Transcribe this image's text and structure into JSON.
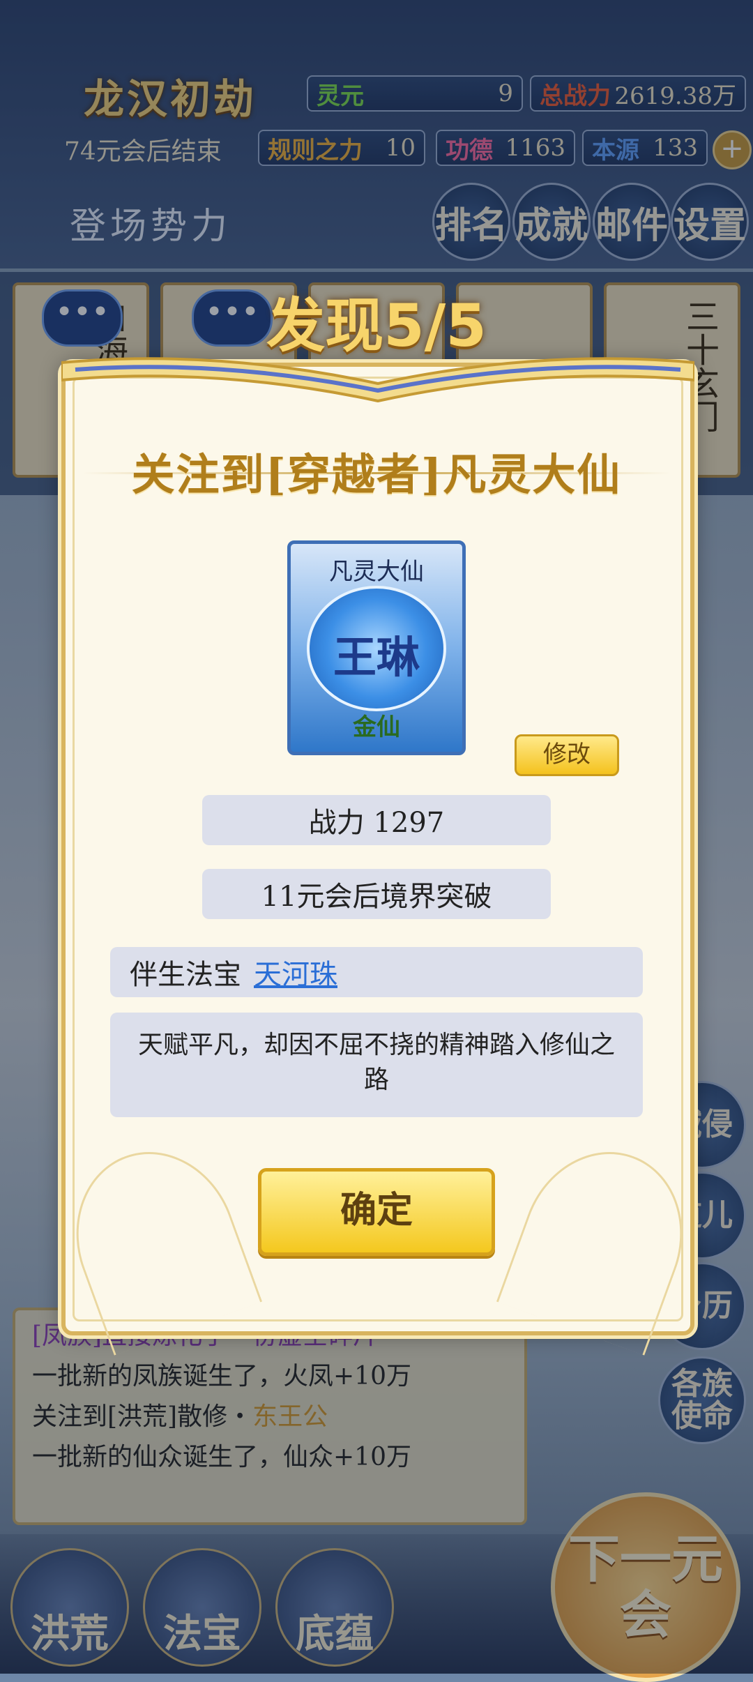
{
  "header": {
    "title": "龙汉初劫",
    "countdown": "74元会后结束",
    "stats": [
      {
        "label": "灵元",
        "value": "9",
        "color": "green"
      },
      {
        "label": "总战力",
        "value": "2619.38万",
        "color": "red"
      },
      {
        "label": "规则之力",
        "value": "10",
        "color": "gold"
      },
      {
        "label": "功德",
        "value": "1163",
        "color": "pink"
      },
      {
        "label": "本源",
        "value": "133",
        "color": "blue"
      }
    ],
    "plus_icon": "plus-icon",
    "faction_label": "登场势力",
    "nav": [
      "排名",
      "成就",
      "邮件",
      "设置"
    ]
  },
  "background_cards": [
    {
      "text": "白海注洋",
      "has_bubble": true
    },
    {
      "text": "",
      "has_bubble": true
    },
    {
      "text": "",
      "has_bubble": false
    },
    {
      "text": "",
      "has_bubble": false
    },
    {
      "text": "三十玄门",
      "has_bubble": false
    }
  ],
  "bubble_glyph": "•••",
  "log": {
    "lines": [
      {
        "text": "[凤族]直接炼化了一份虚空碎片",
        "style": "purple"
      },
      {
        "text": "一批新的凤族诞生了，火凤+10万",
        "style": "normal"
      },
      {
        "prefix": "关注到[洪荒]散修・",
        "highlight": "东王公",
        "style": "mixed"
      },
      {
        "text": "一批新的仙众诞生了，仙众+10万",
        "style": "normal"
      }
    ]
  },
  "side_buttons": [
    "域侵",
    "道儿",
    "身历",
    "各族使命"
  ],
  "bottom_nav": [
    "洪荒",
    "法宝",
    "底蕴"
  ],
  "next_button": "下一元会",
  "dialog": {
    "banner": "发现5/5",
    "title": "关注到[穿越者]凡灵大仙",
    "card": {
      "title": "凡灵大仙",
      "name": "王琳",
      "rank": "金仙"
    },
    "edit_button": "修改",
    "power": "战力 1297",
    "breakthrough": "11元会后境界突破",
    "treasure_label": "伴生法宝",
    "treasure_link": "天河珠",
    "description": "天赋平凡，却因不屈不挠的精神踏入修仙之路",
    "confirm_button": "确定"
  },
  "colors": {
    "dialog_bg": "#fcf8ea",
    "gold_accent": "#d8b45e",
    "link": "#2a6ed6",
    "button_yellow": "#f4c81e"
  }
}
